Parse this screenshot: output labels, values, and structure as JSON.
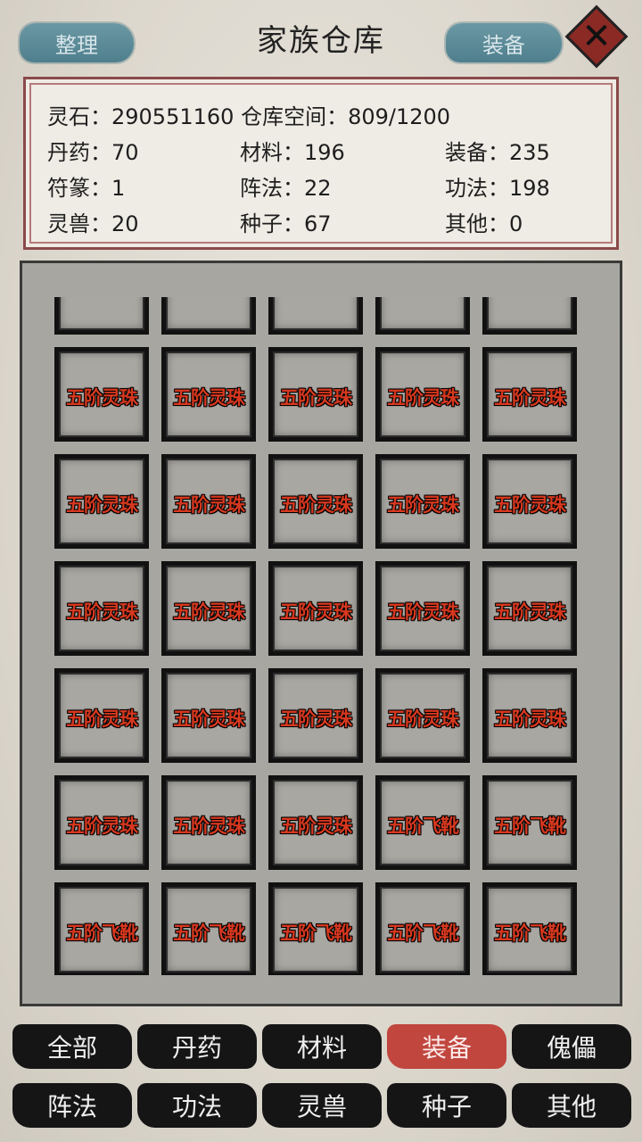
{
  "header": {
    "left_button": "整理",
    "title": "家族仓库",
    "right_button": "装备"
  },
  "summary": {
    "spirit_stones": "灵石：290551160",
    "capacity": "仓库空间：809/1200",
    "cells": [
      [
        "丹药：70",
        "材料：196",
        "装备：235"
      ],
      [
        "符篆：1",
        "阵法：22",
        "功法：198"
      ],
      [
        "灵兽：20",
        "种子：67",
        "其他：0"
      ]
    ]
  },
  "grid": {
    "rows": [
      [
        "五阶灵珠",
        "五阶灵珠",
        "五阶灵珠",
        "五阶灵珠",
        "五阶灵珠"
      ],
      [
        "五阶灵珠",
        "五阶灵珠",
        "五阶灵珠",
        "五阶灵珠",
        "五阶灵珠"
      ],
      [
        "五阶灵珠",
        "五阶灵珠",
        "五阶灵珠",
        "五阶灵珠",
        "五阶灵珠"
      ],
      [
        "五阶灵珠",
        "五阶灵珠",
        "五阶灵珠",
        "五阶灵珠",
        "五阶灵珠"
      ],
      [
        "五阶灵珠",
        "五阶灵珠",
        "五阶灵珠",
        "五阶飞靴",
        "五阶飞靴"
      ],
      [
        "五阶飞靴",
        "五阶飞靴",
        "五阶飞靴",
        "五阶飞靴",
        "五阶飞靴"
      ],
      [
        "五阶飞靴",
        "五阶飞靴",
        "五阶飞靴",
        "五阶飞靴",
        "五阶飞靴"
      ]
    ]
  },
  "tabs": {
    "row1": [
      "全部",
      "丹药",
      "材料",
      "装备",
      "傀儡"
    ],
    "row2": [
      "阵法",
      "功法",
      "灵兽",
      "种子",
      "其他"
    ],
    "active": "装备"
  },
  "colors": {
    "active_tab": "#c0463e",
    "item_label": "#d6381f"
  }
}
